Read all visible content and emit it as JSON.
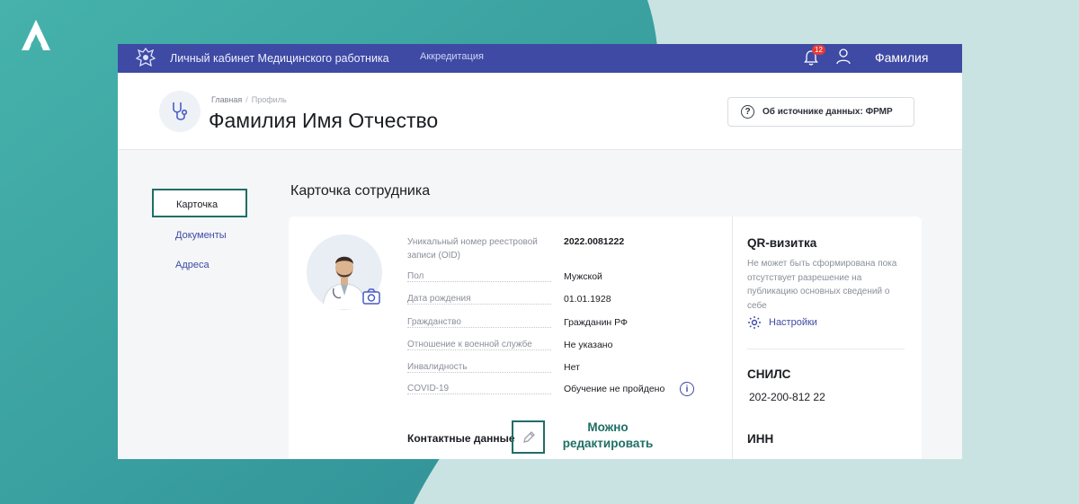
{
  "topbar": {
    "app_title": "Личный кабинет Медицинского работника",
    "nav_accreditation": "Аккредитация",
    "notifications_count": "12",
    "user_name": "Фамилия"
  },
  "header": {
    "breadcrumb_home": "Главная",
    "breadcrumb_separator": "/",
    "breadcrumb_current": "Профиль",
    "page_title": "Фамилия Имя Отчество",
    "source_button": "Об источнике данных: ФРМР"
  },
  "sidebar": {
    "items": [
      {
        "label": "Карточка"
      },
      {
        "label": "Документы"
      },
      {
        "label": "Адреса"
      }
    ]
  },
  "main": {
    "section_title": "Карточка сотрудника",
    "fields": [
      {
        "label": "Уникальный номер реестровой записи (OID)",
        "value": "2022.0081222"
      },
      {
        "label": "Пол",
        "value": "Мужской"
      },
      {
        "label": "Дата рождения",
        "value": "01.01.1928"
      },
      {
        "label": "Гражданство",
        "value": "Гражданин РФ"
      },
      {
        "label": "Отношение к военной службе",
        "value": "Не указано"
      },
      {
        "label": "Инвалидность",
        "value": "Нет"
      },
      {
        "label": "COVID-19",
        "value": "Обучение не пройдено"
      }
    ],
    "contacts_title": "Контактные данные",
    "edit_note": "Можно редактировать"
  },
  "side_panel": {
    "qr_title": "QR-визитка",
    "qr_text": "Не может быть сформирована пока отсутствует разрешение на публикацию основных сведений о себе",
    "settings_label": "Настройки",
    "snils_title": "СНИЛС",
    "snils_value": "202-200-812 22",
    "inn_title": "ИНН"
  },
  "colors": {
    "topbar": "#3e4aa3",
    "accent_teal": "#1f6f66",
    "background_teal": "#3aa39f"
  },
  "icons": [
    "logo-icon",
    "emblem-icon",
    "bell-icon",
    "user-icon",
    "stethoscope-icon",
    "help-icon",
    "camera-icon",
    "info-icon",
    "pencil-icon",
    "gear-icon"
  ]
}
